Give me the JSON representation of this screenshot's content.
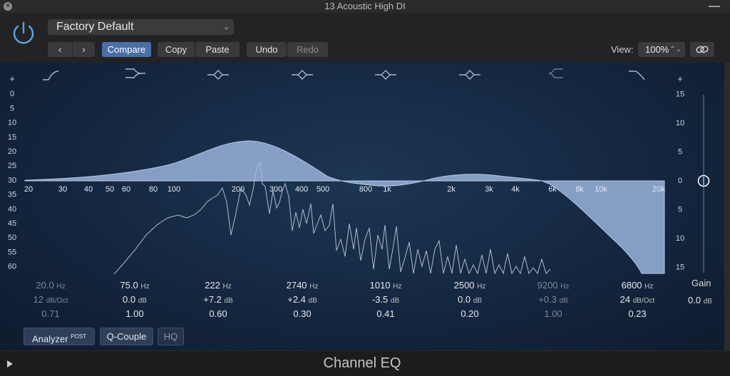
{
  "window": {
    "title": "13 Acoustic High DI"
  },
  "header": {
    "preset": "Factory Default",
    "buttons": {
      "compare": "Compare",
      "copy": "Copy",
      "paste": "Paste",
      "undo": "Undo",
      "redo": "Redo"
    },
    "view_label": "View:",
    "view_value": "100%"
  },
  "graph": {
    "left_scale": [
      "+",
      "0",
      "5",
      "10",
      "15",
      "20",
      "25",
      "30",
      "35",
      "40",
      "45",
      "50",
      "55",
      "60"
    ],
    "right_scale": [
      "+",
      "15",
      "10",
      "5",
      "0",
      "5",
      "10",
      "15"
    ],
    "freq_labels": [
      "20",
      "30",
      "40",
      "50",
      "60",
      "80",
      "100",
      "200",
      "300",
      "400",
      "500",
      "800",
      "1k",
      "2k",
      "3k",
      "4k",
      "6k",
      "8k",
      "10k",
      "20k"
    ]
  },
  "bands": [
    {
      "freq": "20.0",
      "freq_unit": "Hz",
      "gain": "12",
      "gain_unit": "dB/Oct",
      "q": "0.71",
      "enabled": false
    },
    {
      "freq": "75.0",
      "freq_unit": "Hz",
      "gain": "0.0",
      "gain_unit": "dB",
      "q": "1.00",
      "enabled": true
    },
    {
      "freq": "222",
      "freq_unit": "Hz",
      "gain": "+7.2",
      "gain_unit": "dB",
      "q": "0.60",
      "enabled": true
    },
    {
      "freq": "2740",
      "freq_unit": "Hz",
      "gain": "+2.4",
      "gain_unit": "dB",
      "q": "0.30",
      "enabled": true
    },
    {
      "freq": "1010",
      "freq_unit": "Hz",
      "gain": "-3.5",
      "gain_unit": "dB",
      "q": "0.41",
      "enabled": true
    },
    {
      "freq": "2500",
      "freq_unit": "Hz",
      "gain": "0.0",
      "gain_unit": "dB",
      "q": "0.20",
      "enabled": true
    },
    {
      "freq": "9200",
      "freq_unit": "Hz",
      "gain": "+0.3",
      "gain_unit": "dB",
      "q": "1.00",
      "enabled": false
    },
    {
      "freq": "6800",
      "freq_unit": "Hz",
      "gain": "24",
      "gain_unit": "dB/Oct",
      "q": "0.23",
      "enabled": true
    }
  ],
  "gain": {
    "label": "Gain",
    "value": "0.0",
    "unit": "dB"
  },
  "bottom": {
    "analyzer": "Analyzer",
    "analyzer_sup": "POST",
    "qcouple": "Q-Couple",
    "hq": "HQ"
  },
  "footer": {
    "plugin_name": "Channel EQ"
  },
  "colors": {
    "accent": "#4a6fa5",
    "curve_fill": "#8fa9cf",
    "background": "#142740"
  }
}
